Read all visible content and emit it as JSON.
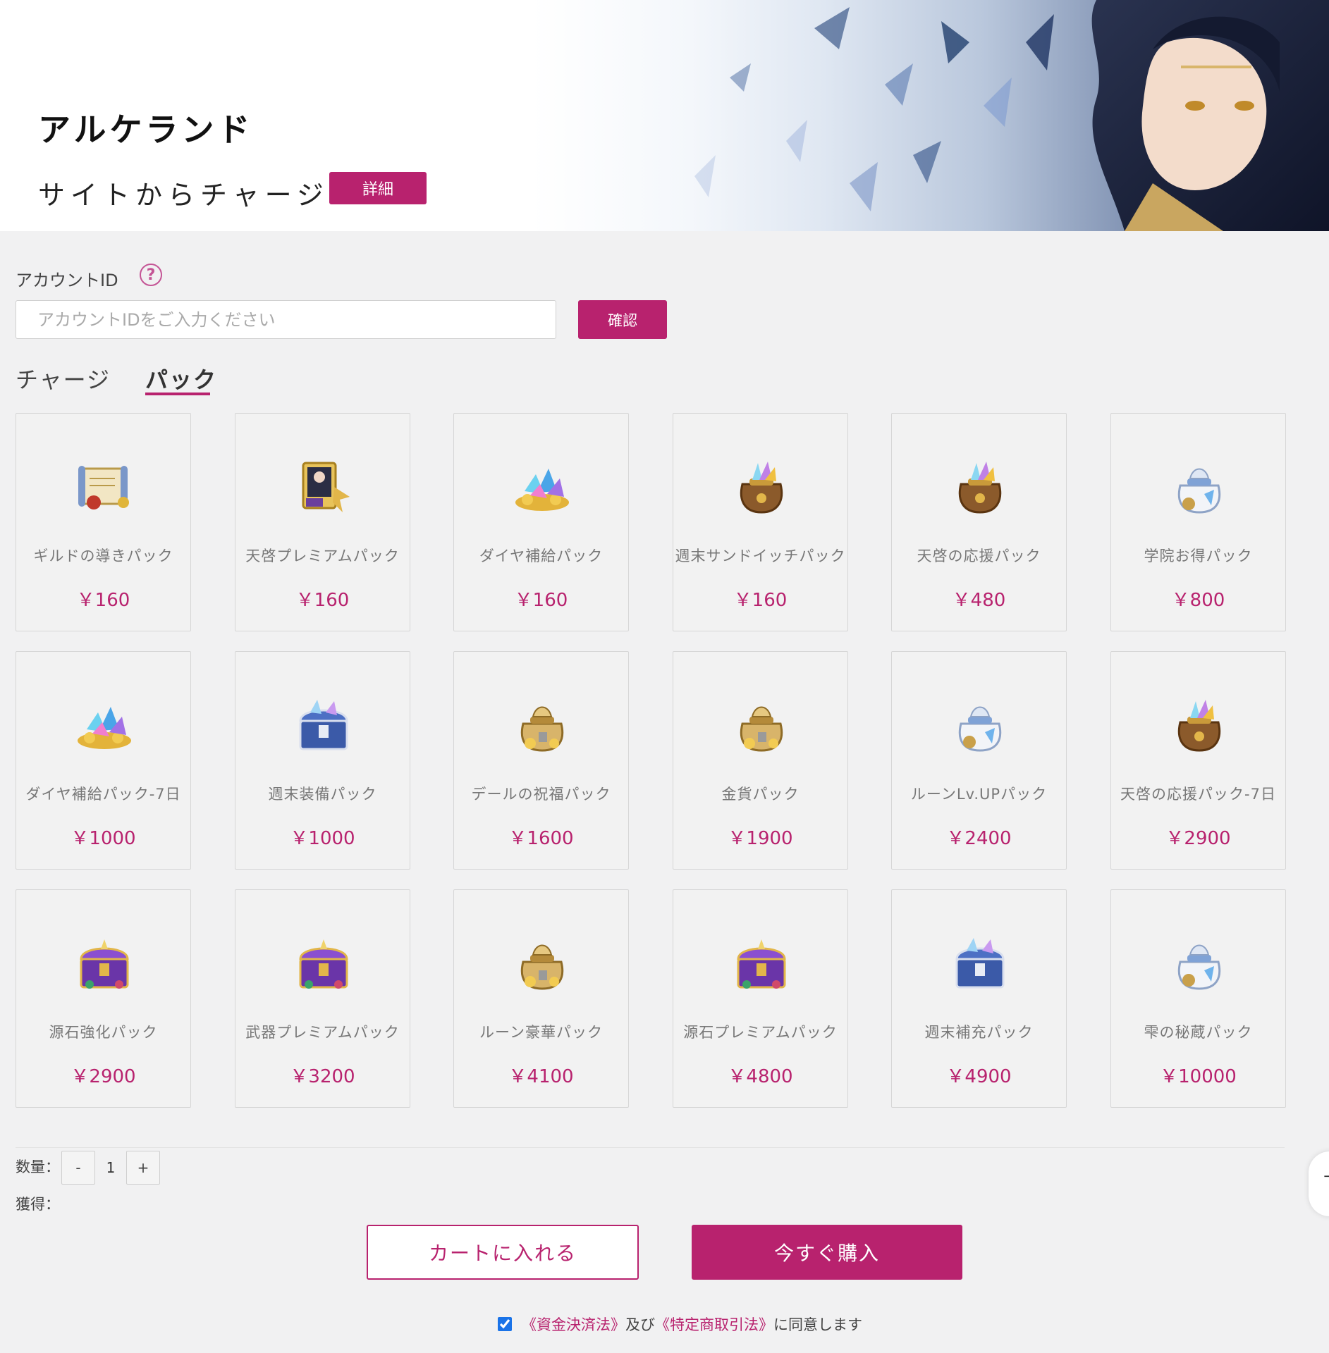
{
  "header": {
    "game_title": "アルケランド",
    "subtitle": "サイトからチャージ",
    "detail_label": "詳細"
  },
  "account": {
    "label": "アカウントID",
    "help_symbol": "?",
    "placeholder": "アカウントIDをご入力ください",
    "value": "",
    "confirm_label": "確認"
  },
  "tabs": [
    {
      "label": "チャージ",
      "active": false
    },
    {
      "label": "パック",
      "active": true
    }
  ],
  "packs": [
    {
      "name": "ギルドの導きパック",
      "price": "￥160",
      "icon": "scroll-icon"
    },
    {
      "name": "天啓プレミアムパック",
      "price": "￥160",
      "icon": "sr-card-icon"
    },
    {
      "name": "ダイヤ補給パック",
      "price": "￥160",
      "icon": "diamond-pile-icon"
    },
    {
      "name": "週末サンドイッチパック",
      "price": "￥160",
      "icon": "brown-bag-icon"
    },
    {
      "name": "天啓の応援パック",
      "price": "￥480",
      "icon": "brown-bag-icon"
    },
    {
      "name": "学院お得パック",
      "price": "￥800",
      "icon": "white-bag-icon"
    },
    {
      "name": "ダイヤ補給パック-7日",
      "price": "￥1000",
      "icon": "diamond-pile-icon"
    },
    {
      "name": "週末装備パック",
      "price": "￥1000",
      "icon": "blue-chest-icon"
    },
    {
      "name": "デールの祝福パック",
      "price": "￥1600",
      "icon": "gold-bag-icon"
    },
    {
      "name": "金貨パック",
      "price": "￥1900",
      "icon": "gold-bag-icon"
    },
    {
      "name": "ルーンLv.UPパック",
      "price": "￥2400",
      "icon": "white-bag-icon"
    },
    {
      "name": "天啓の応援パック-7日",
      "price": "￥2900",
      "icon": "brown-bag-icon"
    },
    {
      "name": "源石強化パック",
      "price": "￥2900",
      "icon": "purple-chest-icon"
    },
    {
      "name": "武器プレミアムパック",
      "price": "￥3200",
      "icon": "purple-chest-icon"
    },
    {
      "name": "ルーン豪華パック",
      "price": "￥4100",
      "icon": "gold-bag-icon"
    },
    {
      "name": "源石プレミアムパック",
      "price": "￥4800",
      "icon": "purple-chest-icon"
    },
    {
      "name": "週末補充パック",
      "price": "￥4900",
      "icon": "blue-chest-icon"
    },
    {
      "name": "雫の秘蔵パック",
      "price": "￥10000",
      "icon": "white-bag-icon"
    }
  ],
  "quantity": {
    "label": "数量：",
    "minus": "-",
    "value": "1",
    "plus": "+"
  },
  "obtain_label": "獲得：",
  "actions": {
    "cart_label": "カートに入れる",
    "buy_label": "今すぐ購入"
  },
  "agreement": {
    "checked": true,
    "law1": "《資金決済法》",
    "and_text": "及び",
    "law2": "《特定商取引法》",
    "suffix": "に同意します"
  },
  "side_tab_glyph": "⊤",
  "colors": {
    "accent": "#b8226e",
    "background": "#f1f1f2",
    "card_border": "#d6d6d6"
  }
}
